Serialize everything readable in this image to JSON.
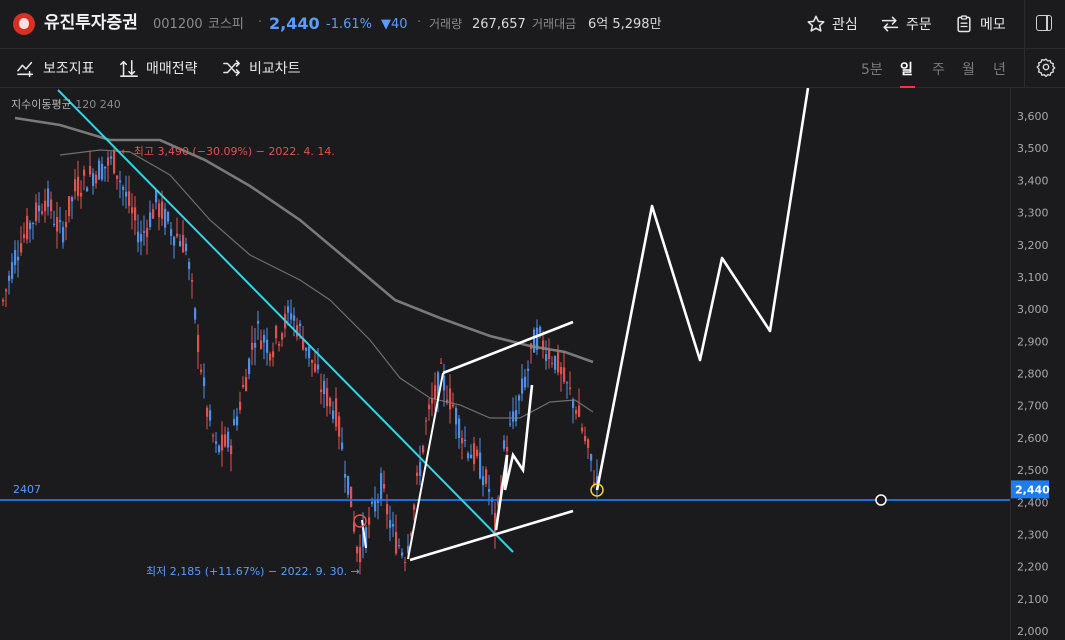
{
  "header": {
    "stock_name": "유진투자증권",
    "code": "001200",
    "market": "코스피",
    "separator": "·",
    "price": "2,440",
    "change_pct": "-1.61%",
    "change_abs": "▼40",
    "volume_label": "거래량",
    "volume_value": "267,657",
    "amount_label": "거래대금",
    "amount_value": "6억 5,298만",
    "watch_label": "관심",
    "order_label": "주문",
    "memo_label": "메모"
  },
  "toolbar": {
    "indicator_label": "보조지표",
    "strategy_label": "매매전략",
    "compare_label": "비교차트",
    "periods": [
      "5분",
      "일",
      "주",
      "월",
      "년"
    ],
    "active_period": "일"
  },
  "chart_data": {
    "type": "candlestick",
    "legend": "지수이동평균",
    "legend_params": "120 240",
    "y_ticks": [
      "3,600",
      "3,500",
      "3,400",
      "3,300",
      "3,200",
      "3,100",
      "3,000",
      "2,900",
      "2,800",
      "2,700",
      "2,600",
      "2,500",
      "2,400",
      "2,300",
      "2,200",
      "2,100",
      "2,000"
    ],
    "ylim": [
      2000,
      3600
    ],
    "current_price_label": "2,440",
    "current_price": 2440,
    "horizontal_line_label": "2407",
    "horizontal_line_value": 2407,
    "high_annotation": "최고 3,490 (−30.09%) − 2022. 4. 14.",
    "low_annotation": "최저 2,185 (+11.67%) − 2022. 9. 30. →",
    "colors": {
      "up": "#e0524e",
      "down": "#4f8fe6",
      "ma": "#8d8d8d",
      "trend": "#2ed6e8",
      "line": "#1e7bf0",
      "drawing": "#ffffff"
    }
  }
}
